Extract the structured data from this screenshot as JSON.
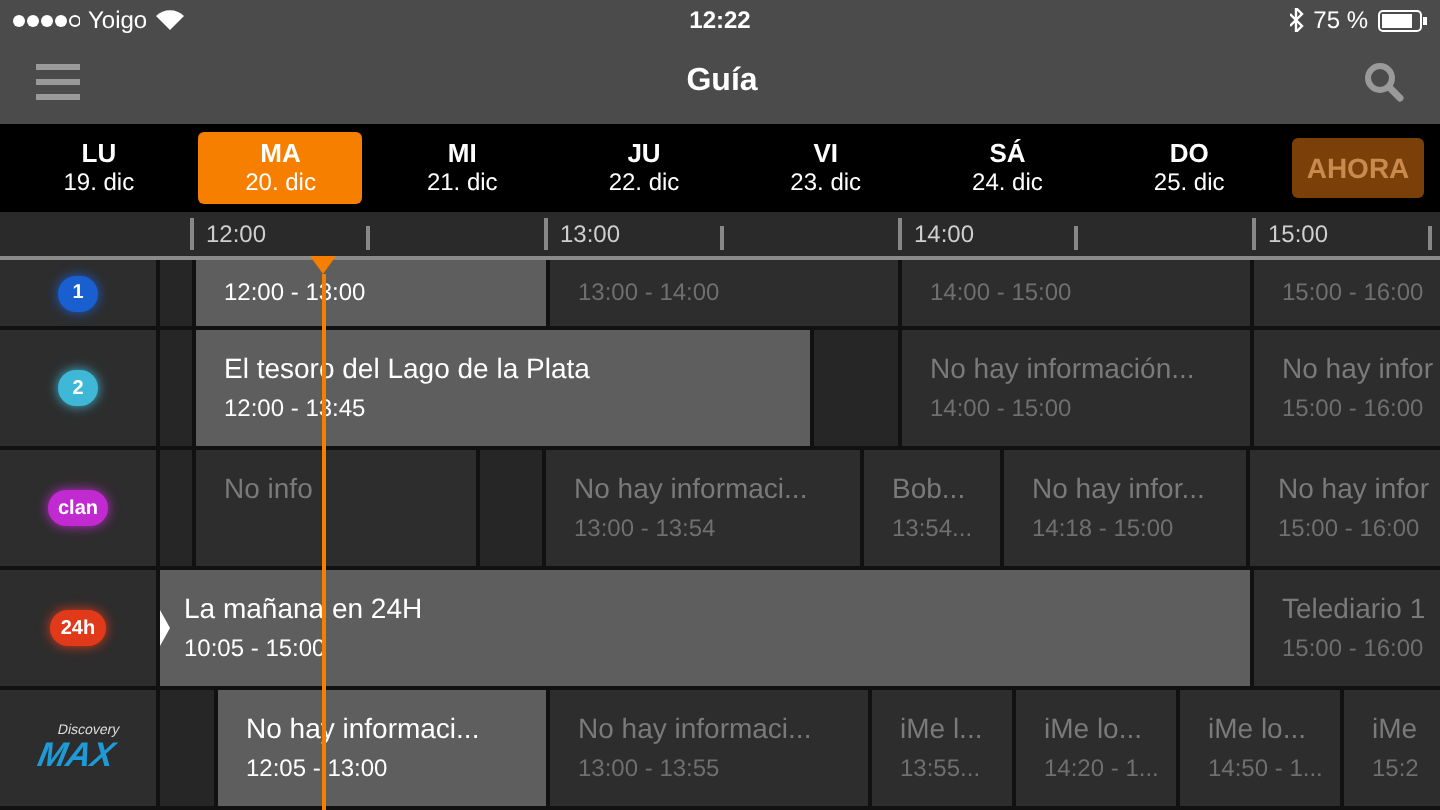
{
  "status_bar": {
    "carrier": "Yoigo",
    "time": "12:22",
    "battery": "75 %"
  },
  "nav": {
    "title": "Guía"
  },
  "days": [
    {
      "day": "LU",
      "date": "19. dic",
      "selected": false
    },
    {
      "day": "MA",
      "date": "20. dic",
      "selected": true
    },
    {
      "day": "MI",
      "date": "21. dic",
      "selected": false
    },
    {
      "day": "JU",
      "date": "22. dic",
      "selected": false
    },
    {
      "day": "VI",
      "date": "23. dic",
      "selected": false
    },
    {
      "day": "SÁ",
      "date": "24. dic",
      "selected": false
    },
    {
      "day": "DO",
      "date": "25. dic",
      "selected": false
    }
  ],
  "now_button": "AHORA",
  "ruler": [
    "12:00",
    "13:00",
    "14:00",
    "15:00"
  ],
  "channels": [
    {
      "logo": [
        "1"
      ],
      "color": "#1a5fd0",
      "programs": [
        {
          "kind": "empty"
        },
        {
          "kind": "current",
          "time": "12:00 - 13:00"
        },
        {
          "kind": "other",
          "time": "13:00 - 14:00"
        },
        {
          "kind": "other",
          "time": "14:00 - 15:00"
        },
        {
          "kind": "other",
          "time": "15:00 - 16:00"
        }
      ]
    },
    {
      "logo": [
        "2"
      ],
      "color": "#3fb8d8",
      "programs": [
        {
          "kind": "empty"
        },
        {
          "kind": "current",
          "title": "El tesoro del Lago de la Plata",
          "time": "12:00 - 13:45"
        },
        {
          "kind": "empty"
        },
        {
          "kind": "other",
          "title": "No hay información...",
          "time": "14:00 - 15:00"
        },
        {
          "kind": "other",
          "title": "No hay infor",
          "time": "15:00 - 16:00"
        }
      ]
    },
    {
      "logo": [
        "clan"
      ],
      "color": "#c02ad0",
      "programs": [
        {
          "kind": "empty"
        },
        {
          "kind": "other",
          "title": "No info"
        },
        {
          "kind": "empty"
        },
        {
          "kind": "other",
          "title": "No hay informaci...",
          "time": "13:00 - 13:54"
        },
        {
          "kind": "other",
          "title": "Bob...",
          "time": "13:54..."
        },
        {
          "kind": "other",
          "title": "No hay infor...",
          "time": "14:18 - 15:00"
        },
        {
          "kind": "other",
          "title": "No hay infor",
          "time": "15:00 - 16:00"
        }
      ]
    },
    {
      "logo": [
        "24h"
      ],
      "color": "#e03a1a",
      "programs": [
        {
          "kind": "current",
          "title": "La mañana en 24H",
          "time": "10:05 - 15:00",
          "continues": true
        },
        {
          "kind": "other",
          "title": "Telediario 1",
          "time": "15:00 - 16:00"
        }
      ]
    },
    {
      "logo": [
        "Discovery",
        "MAX"
      ],
      "color": "#1e9ad6",
      "programs": [
        {
          "kind": "empty"
        },
        {
          "kind": "current",
          "title": "No hay informaci...",
          "time": "12:05 - 13:00"
        },
        {
          "kind": "other",
          "title": "No hay informaci...",
          "time": "13:00 - 13:55"
        },
        {
          "kind": "other",
          "title": "iMe l...",
          "time": "13:55..."
        },
        {
          "kind": "other",
          "title": "iMe lo...",
          "time": "14:20 - 1..."
        },
        {
          "kind": "other",
          "title": "iMe lo...",
          "time": "14:50 - 1..."
        },
        {
          "kind": "other",
          "title": "iMe",
          "time": "15:2"
        }
      ]
    }
  ]
}
